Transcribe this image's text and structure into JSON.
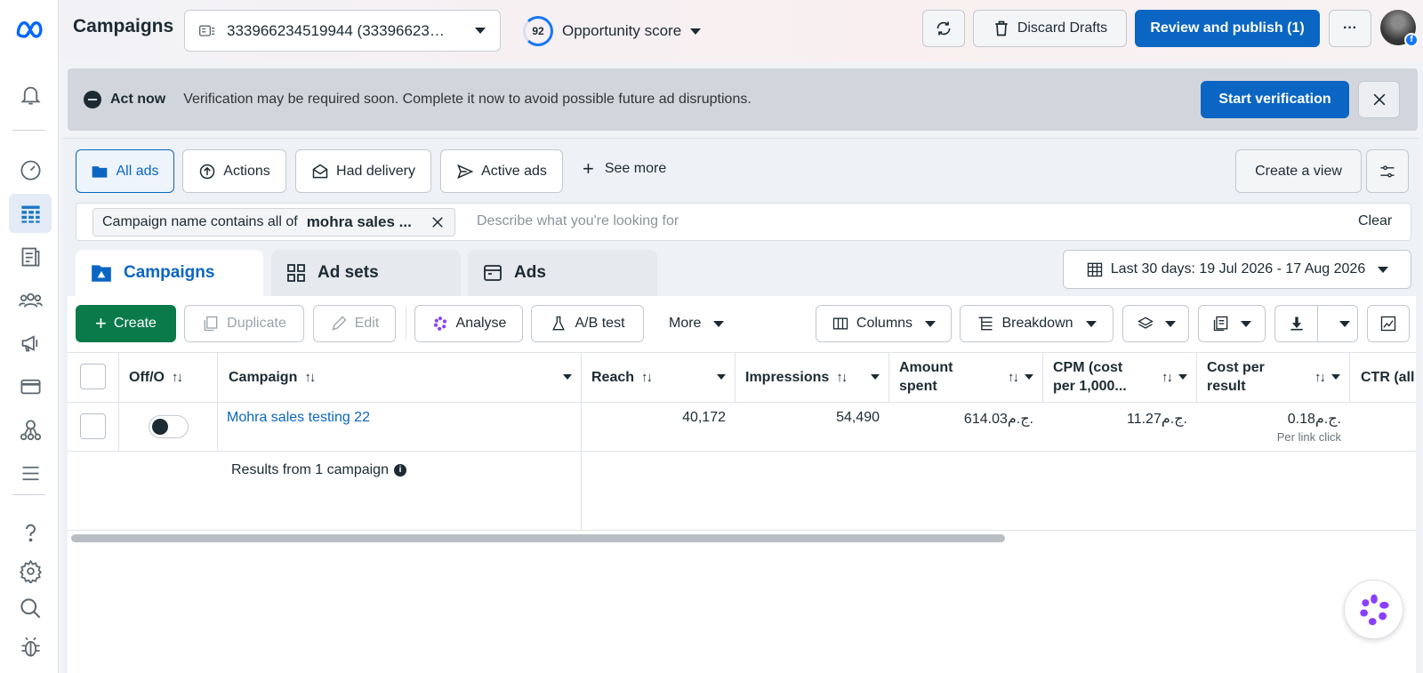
{
  "header": {
    "title": "Campaigns",
    "account": "333966234519944 (33396623…",
    "opportunity_score": "92",
    "opportunity_label": "Opportunity score",
    "discard": "Discard Drafts",
    "review": "Review and publish (1)"
  },
  "banner": {
    "title": "Act now",
    "message": "Verification may be required soon. Complete it now to avoid possible future ad disruptions.",
    "action": "Start verification"
  },
  "views": {
    "all_ads": "All ads",
    "actions": "Actions",
    "had_delivery": "Had delivery",
    "active_ads": "Active ads",
    "see_more": "See more",
    "create_view": "Create a view"
  },
  "filter": {
    "chip_prefix": "Campaign name contains all of",
    "chip_value": "mohra sales ...",
    "placeholder": "Describe what you're looking for",
    "clear": "Clear"
  },
  "tabs": {
    "campaigns": "Campaigns",
    "ad_sets": "Ad sets",
    "ads": "Ads"
  },
  "date_range": "Last 30 days: 19 Jul 2026 - 17 Aug 2026",
  "toolbar": {
    "create": "Create",
    "duplicate": "Duplicate",
    "edit": "Edit",
    "analyse": "Analyse",
    "ab_test": "A/B test",
    "more": "More",
    "columns": "Columns",
    "breakdown": "Breakdown"
  },
  "table": {
    "headers": {
      "off": "Off/O",
      "campaign": "Campaign",
      "reach": "Reach",
      "impressions": "Impressions",
      "amount1": "Amount",
      "amount2": "spent",
      "cpm1": "CPM (cost",
      "cpm2": "per 1,000...",
      "cpr1": "Cost per",
      "cpr2": "result",
      "ctr": "CTR (all"
    },
    "row": {
      "name": "Mohra sales testing 22",
      "reach": "40,172",
      "impressions": "54,490",
      "amount": "614.03ج.م.",
      "cpm": "11.27ج.م.",
      "cost_per_result": "0.18ج.م.",
      "result_type": "Per link click"
    },
    "summary": "Results from 1 campaign"
  },
  "colors": {
    "accent": "#0a66c2",
    "green": "#0b7a4b"
  }
}
